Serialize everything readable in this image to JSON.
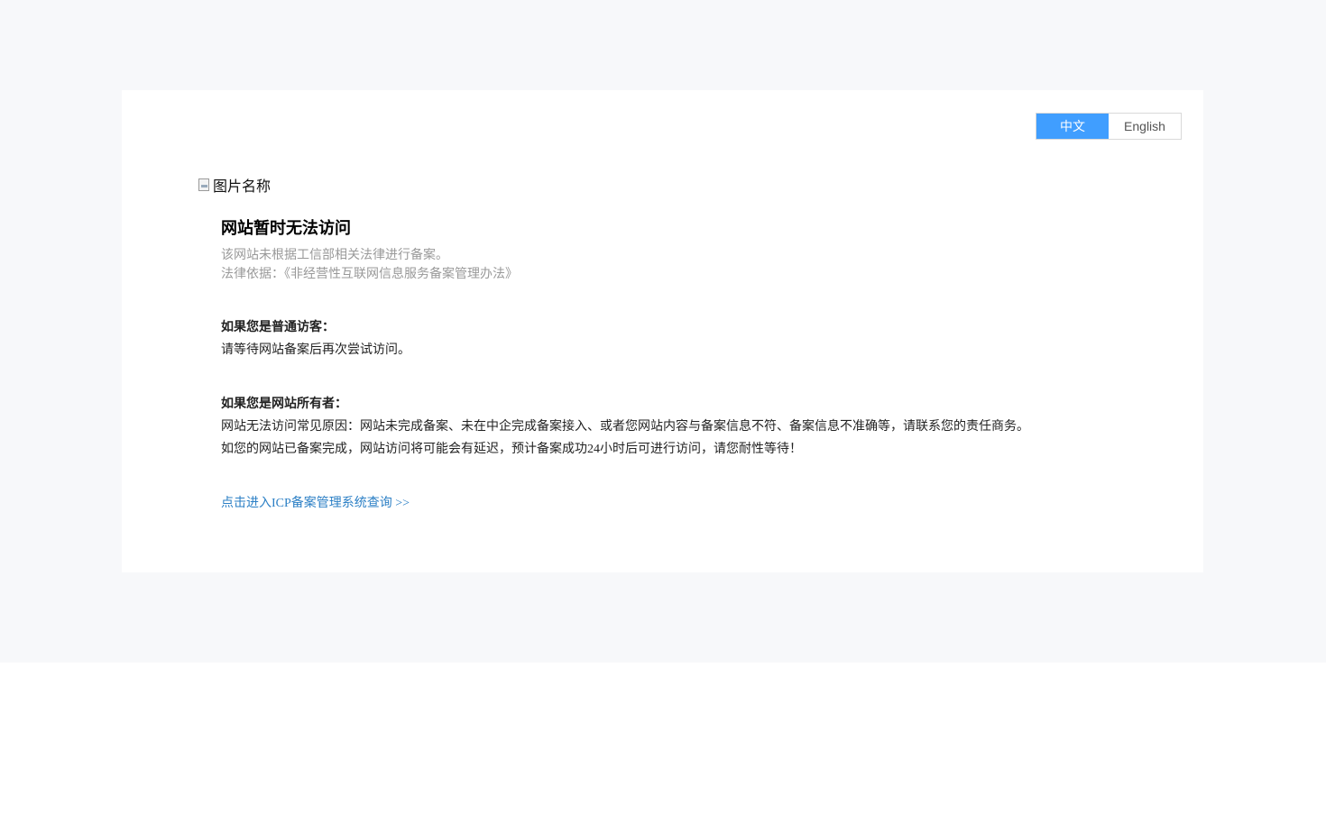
{
  "lang_switch": {
    "items": [
      {
        "label": "中文",
        "active": true
      },
      {
        "label": "English",
        "active": false
      }
    ]
  },
  "image_alt": "图片名称",
  "title": "网站暂时无法访问",
  "notice": {
    "line1": "该网站未根据工信部相关法律进行备案。",
    "line2": "法律依据：《非经营性互联网信息服务备案管理办法》"
  },
  "visitor": {
    "heading": "如果您是普通访客：",
    "text": "请等待网站备案后再次尝试访问。"
  },
  "owner": {
    "heading": "如果您是网站所有者：",
    "line1": "网站无法访问常见原因：网站未完成备案、未在中企完成备案接入、或者您网站内容与备案信息不符、备案信息不准确等，请联系您的责任商务。",
    "line2": "如您的网站已备案完成，网站访问将可能会有延迟，预计备案成功24小时后可进行访问，请您耐性等待！"
  },
  "icp_link": "点击进入ICP备案管理系统查询 >>",
  "colors": {
    "accent": "#409eff",
    "link": "#2b7fc5",
    "page_bg": "#f7f8fa",
    "muted_text": "#999999"
  }
}
